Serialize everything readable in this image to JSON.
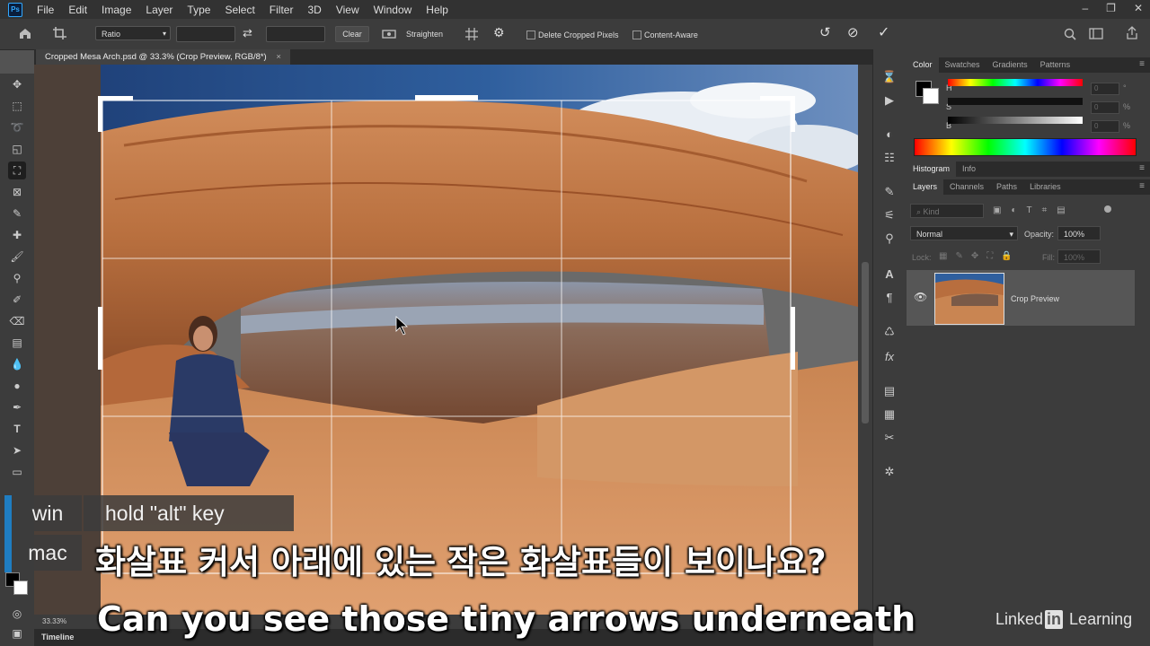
{
  "app": {
    "logo": "Ps",
    "menu": [
      "File",
      "Edit",
      "Image",
      "Layer",
      "Type",
      "Select",
      "Filter",
      "3D",
      "View",
      "Window",
      "Help"
    ],
    "window_controls": [
      "–",
      "❐",
      "✕"
    ]
  },
  "options_bar": {
    "ratio": "Ratio",
    "clear": "Clear",
    "straighten": "Straighten",
    "delete_cropped": "Delete Cropped Pixels",
    "content_aware": "Content-Aware"
  },
  "document": {
    "tab_title": "Cropped Mesa Arch.psd @ 33.3% (Crop Preview, RGB/8*)",
    "tab_close": "×",
    "zoom": "33.33%",
    "timeline": "Timeline"
  },
  "color_panel": {
    "tabs": [
      "Color",
      "Swatches",
      "Gradients",
      "Patterns"
    ],
    "labels": [
      "H",
      "S",
      "B"
    ],
    "values": [
      "0",
      "0",
      "0"
    ],
    "unit": "%"
  },
  "histogram_panel": {
    "tabs": [
      "Histogram",
      "Info"
    ]
  },
  "layers_panel": {
    "tabs": [
      "Layers",
      "Channels",
      "Paths",
      "Libraries"
    ],
    "kind": "Kind",
    "blend_mode": "Normal",
    "opacity_label": "Opacity:",
    "opacity": "100%",
    "lock_label": "Lock:",
    "fill_label": "Fill:",
    "fill": "100%",
    "layer_name": "Crop Preview"
  },
  "caption": {
    "win_label": "win",
    "win_text": "hold \"alt\" key",
    "mac_label": "mac"
  },
  "subtitles": {
    "korean": "화살표 커서 아래에 있는 작은 화살표들이 보이나요?",
    "english": "Can you see those tiny arrows underneath"
  },
  "watermark": {
    "pre": "Linked",
    "in": "in",
    "post": " Learning"
  },
  "colors": {
    "accent": "#31a8ff",
    "panel_bg": "#3c3c3c",
    "app_bg": "#323232"
  }
}
